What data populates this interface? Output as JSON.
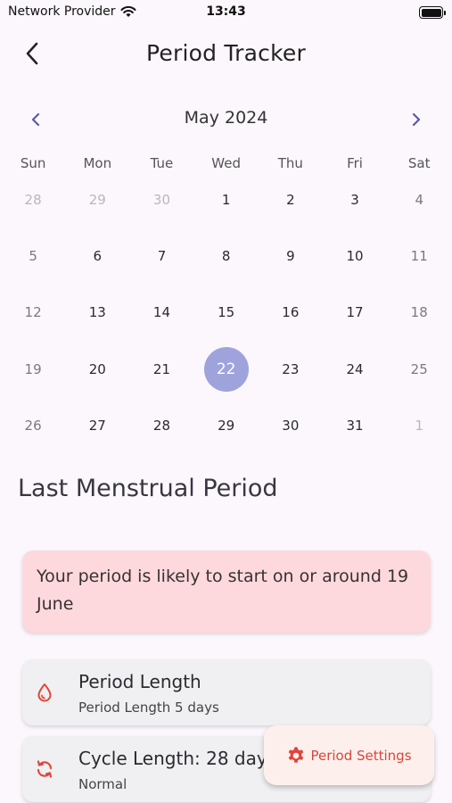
{
  "status_bar": {
    "carrier": "Network Provider",
    "time": "13:43"
  },
  "app_bar": {
    "title": "Period Tracker"
  },
  "calendar": {
    "month_label": "May 2024",
    "weekdays": [
      "Sun",
      "Mon",
      "Tue",
      "Wed",
      "Thu",
      "Fri",
      "Sat"
    ],
    "days": [
      {
        "d": "28",
        "muted": true
      },
      {
        "d": "29",
        "muted": true
      },
      {
        "d": "30",
        "muted": true
      },
      {
        "d": "1"
      },
      {
        "d": "2"
      },
      {
        "d": "3"
      },
      {
        "d": "4",
        "weekend": true
      },
      {
        "d": "5",
        "weekend": true
      },
      {
        "d": "6"
      },
      {
        "d": "7"
      },
      {
        "d": "8"
      },
      {
        "d": "9"
      },
      {
        "d": "10"
      },
      {
        "d": "11",
        "weekend": true
      },
      {
        "d": "12",
        "weekend": true
      },
      {
        "d": "13"
      },
      {
        "d": "14"
      },
      {
        "d": "15"
      },
      {
        "d": "16"
      },
      {
        "d": "17"
      },
      {
        "d": "18",
        "weekend": true
      },
      {
        "d": "19",
        "weekend": true
      },
      {
        "d": "20"
      },
      {
        "d": "21"
      },
      {
        "d": "22",
        "selected": true
      },
      {
        "d": "23"
      },
      {
        "d": "24"
      },
      {
        "d": "25",
        "weekend": true
      },
      {
        "d": "26",
        "weekend": true
      },
      {
        "d": "27"
      },
      {
        "d": "28"
      },
      {
        "d": "29"
      },
      {
        "d": "30"
      },
      {
        "d": "31"
      },
      {
        "d": "1",
        "muted": true
      }
    ]
  },
  "section_title": "Last Menstrual Period",
  "alert": {
    "text": "Your period is likely to start on or around 19 June"
  },
  "cards": {
    "period": {
      "title": "Period Length",
      "subtitle": "Period Length 5 days",
      "icon": "drop-icon"
    },
    "cycle": {
      "title": "Cycle Length: 28 days",
      "subtitle": "Normal",
      "icon": "refresh-icon"
    }
  },
  "fab": {
    "label": "Period Settings",
    "icon": "gear-icon"
  },
  "colors": {
    "accent": "#9fa3db",
    "alert_bg": "#fdd9de",
    "icon_red": "#e0453a",
    "nav_arrow": "#5a5aa8"
  }
}
